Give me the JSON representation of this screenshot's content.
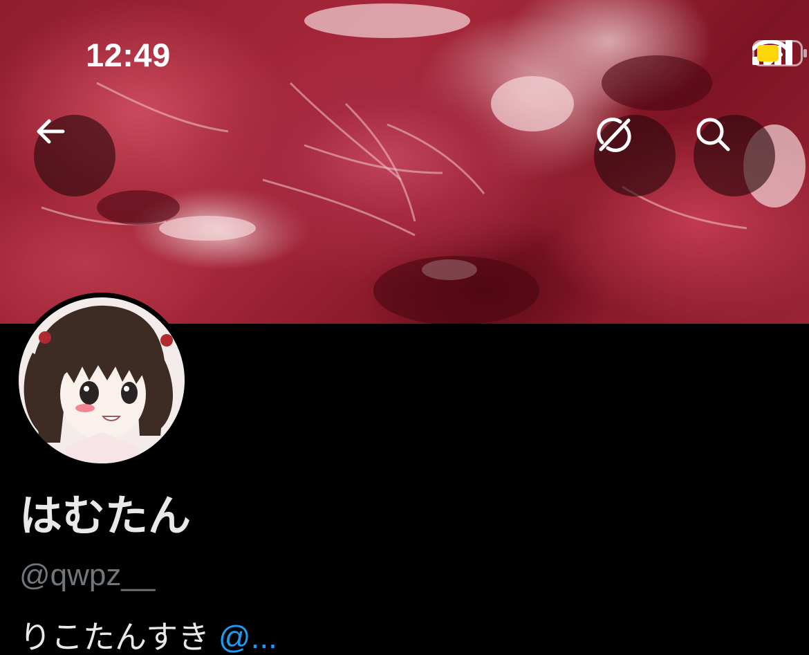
{
  "status_bar": {
    "time": "12:49",
    "icons": [
      "cellular-signal-icon",
      "wifi-icon",
      "battery-icon"
    ],
    "battery_color": "#ffd60a"
  },
  "header": {
    "buttons": [
      {
        "name": "back-button",
        "icon": "arrow-left-icon"
      },
      {
        "name": "grok-button",
        "icon": "grok-icon"
      },
      {
        "name": "search-button",
        "icon": "search-icon"
      }
    ]
  },
  "profile": {
    "display_name": "はむたん",
    "handle": "@qwpz__",
    "bio_text": "りこたんすき",
    "bio_mention": "@...",
    "mention_color": "#1d9bf0"
  }
}
